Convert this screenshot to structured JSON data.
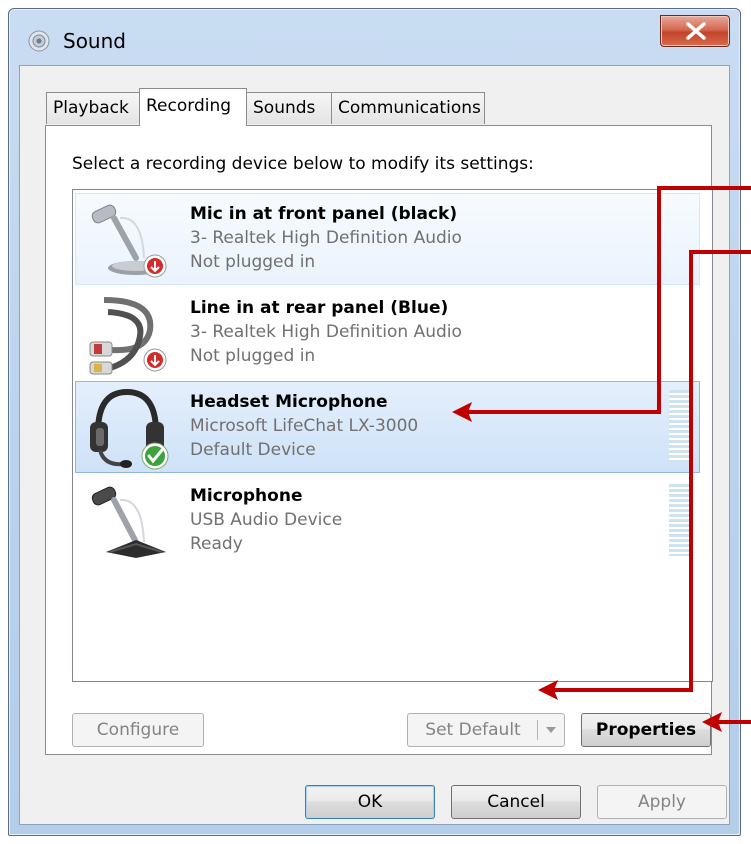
{
  "window": {
    "title": "Sound"
  },
  "tabs": [
    {
      "label": "Playback"
    },
    {
      "label": "Recording"
    },
    {
      "label": "Sounds"
    },
    {
      "label": "Communications"
    }
  ],
  "recording": {
    "instruction": "Select a recording device below to modify its settings:",
    "devices": [
      {
        "name": "Mic in at front panel (black)",
        "driver": "3- Realtek High Definition Audio",
        "status": "Not plugged in",
        "icon": "microphone-unplugged-icon"
      },
      {
        "name": "Line in at rear panel (Blue)",
        "driver": "3- Realtek High Definition Audio",
        "status": "Not plugged in",
        "icon": "line-in-cable-unplugged-icon"
      },
      {
        "name": "Headset Microphone",
        "driver": "Microsoft LifeChat LX-3000",
        "status": "Default Device",
        "icon": "headset-default-icon"
      },
      {
        "name": "Microphone",
        "driver": "USB Audio Device",
        "status": "Ready",
        "icon": "microphone-icon"
      }
    ],
    "buttons": {
      "configure": "Configure",
      "set_default": "Set Default",
      "properties": "Properties"
    }
  },
  "footer": {
    "ok": "OK",
    "cancel": "Cancel",
    "apply": "Apply"
  },
  "colors": {
    "annotation_arrow": "#c00000",
    "selection": "#cfe2f8"
  }
}
